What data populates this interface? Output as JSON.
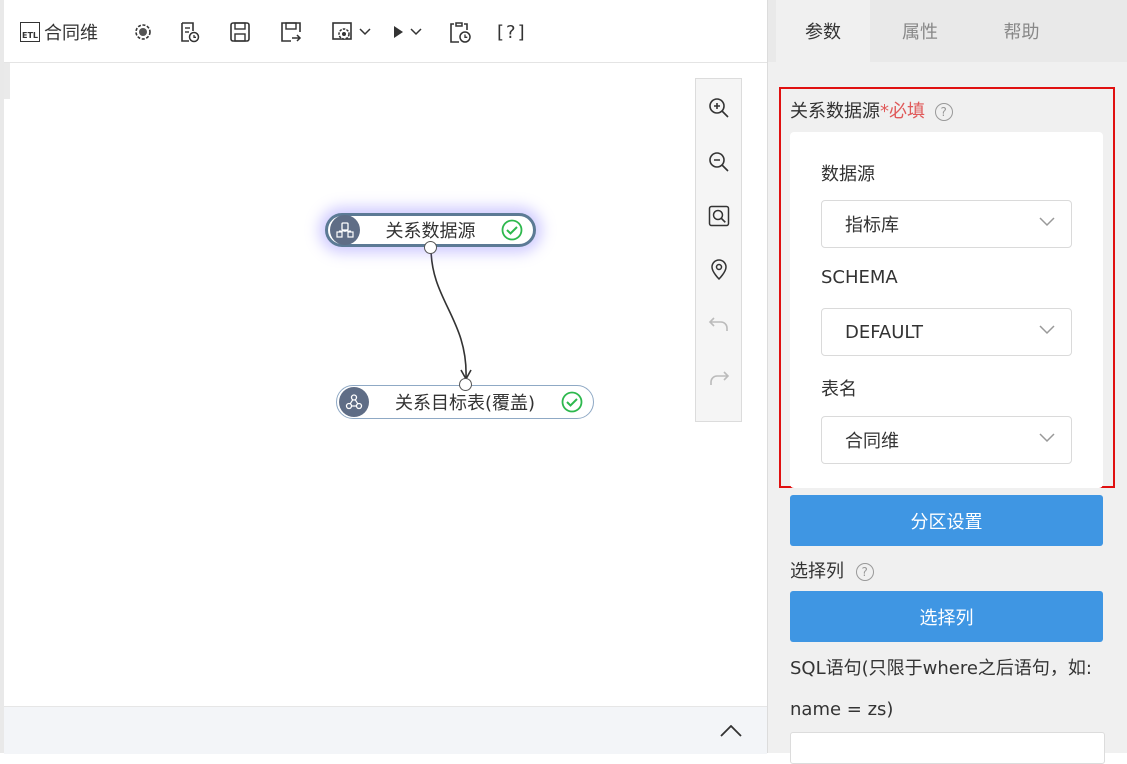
{
  "toolbar": {
    "title_icon_text": "ETL",
    "title": "合同维",
    "help_label": "[?]"
  },
  "canvas": {
    "source_node_label": "关系数据源",
    "target_node_label": "关系目标表(覆盖)"
  },
  "tabs": [
    {
      "label": "参数"
    },
    {
      "label": "属性"
    },
    {
      "label": "帮助"
    }
  ],
  "params": {
    "section_title": "关系数据源",
    "required_mark": "*必填",
    "datasource_label": "数据源",
    "datasource_value": "指标库",
    "schema_label": "SCHEMA",
    "schema_value": "DEFAULT",
    "table_label": "表名",
    "table_value": "合同维",
    "partition_button": "分区设置",
    "select_columns_label": "选择列",
    "select_columns_button": "选择列",
    "sql_label_line1": "SQL语句(只限于where之后语句，如:",
    "sql_label_line2": "name = zs)"
  },
  "colors": {
    "accent": "#3f96e3",
    "highlight_border": "#e01010",
    "node_icon": "#5f6d86",
    "success": "#2db84d",
    "required": "#e05a5a"
  }
}
